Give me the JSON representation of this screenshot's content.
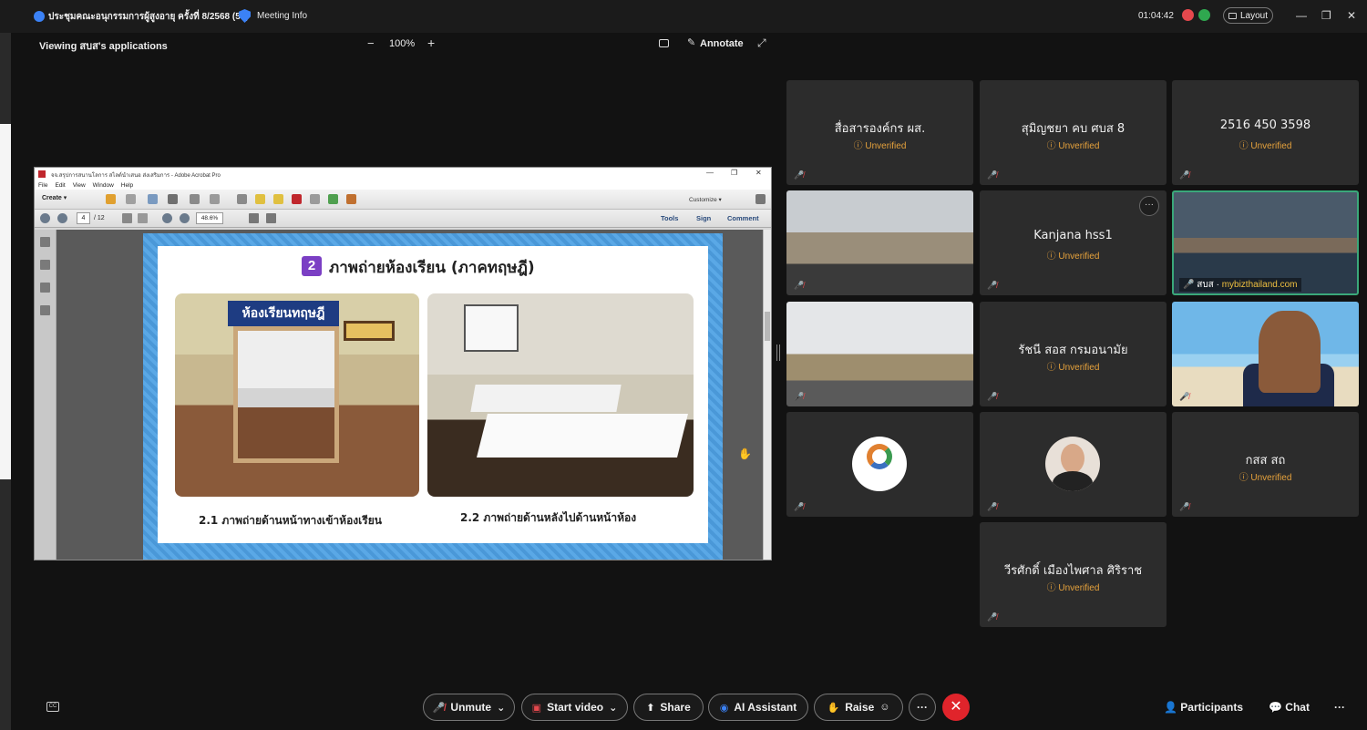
{
  "titlebar": {
    "meeting_title": "ประชุมคณะอนุกรรมการผู้สูงอายุ ครั้งที่ 8/2568 (59)",
    "meeting_info": "Meeting Info",
    "time": "01:04:42",
    "layout": "Layout"
  },
  "share_toolbar": {
    "viewing": "Viewing สบส's applications",
    "zoom_minus": "−",
    "zoom": "100%",
    "zoom_plus": "+",
    "annotate": "Annotate"
  },
  "acrobat": {
    "window_title": "จจ.สรุปการสนานโลการ สไลด์นำเสนอ ส่งเสริมการ - Adobe Acrobat Pro",
    "menu": [
      "File",
      "Edit",
      "View",
      "Window",
      "Help"
    ],
    "create": "Create ▾",
    "customize": "Customize ▾",
    "page_current": "4",
    "page_total": "/ 12",
    "zoom": "48.6%",
    "right_links": [
      "Tools",
      "Sign",
      "Comment"
    ]
  },
  "slide": {
    "number": "2",
    "title": "ภาพถ่ายห้องเรียน (ภาคทฤษฎี)",
    "sign_text": "ห้องเรียนทฤษฎี",
    "caption_1": "2.1 ภาพถ่ายด้านหน้าทางเข้าห้องเรียน",
    "caption_2": "2.2 ภาพถ่ายด้านหลังไปด้านหน้าห้อง"
  },
  "participants": [
    {
      "name": "สื่อสารองค์กร ผส.",
      "status": "Unverified"
    },
    {
      "name": "สุมิญชยา คบ ศบส 8",
      "status": "Unverified"
    },
    {
      "name": "2516 450 3598",
      "status": "Unverified"
    },
    {
      "name": "Kanjana hss1",
      "status": "Unverified"
    },
    {
      "name": "สบส",
      "link": "mybizthailand.com"
    },
    {
      "name": "รัชนี สอส กรมอนามัย",
      "status": "Unverified"
    },
    {
      "name": "กสส สถ",
      "status": "Unverified"
    },
    {
      "name": "วีรศักดิ์ เมืองไพศาล ศิริราช",
      "status": "Unverified"
    }
  ],
  "bottom_bar": {
    "unmute": "Unmute",
    "start_video": "Start video",
    "share": "Share",
    "ai_assistant": "AI Assistant",
    "raise": "Raise",
    "more": "···",
    "participants": "Participants",
    "chat": "Chat",
    "overflow": "···"
  },
  "colors": {
    "unverified": "#e6a23c",
    "end_call": "#e0242b",
    "active_speaker_border": "#3aa87a",
    "brand_blue": "#3b82f6"
  }
}
